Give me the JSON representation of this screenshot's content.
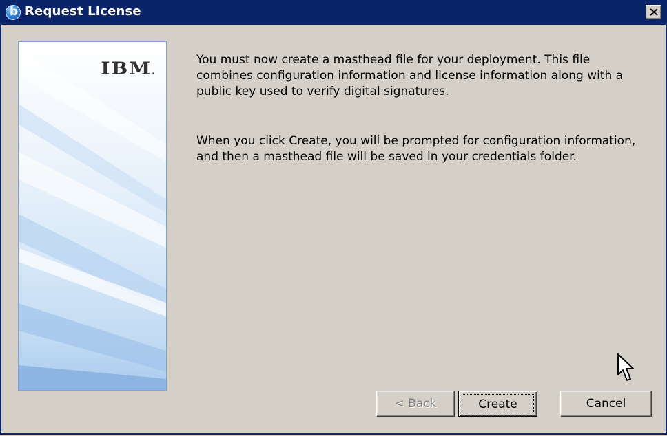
{
  "window": {
    "title": "Request License",
    "app_icon": "b-app-icon",
    "close_icon": "close-icon"
  },
  "side_panel": {
    "logo_text": "IBM"
  },
  "content": {
    "paragraph_1": "You must now create a masthead file for your deployment.  This file combines configuration information and license information along with a public key used to verify digital signatures.",
    "paragraph_2": "When you click Create, you will be prompted for configuration information, and then a masthead file will be saved in your credentials folder."
  },
  "buttons": {
    "back_label": "< Back",
    "create_label": "Create",
    "cancel_label": "Cancel"
  },
  "colors": {
    "titlebar": "#0a246a",
    "dialog_face": "#d4d0c8",
    "panel_accent": "#a9cbef"
  }
}
